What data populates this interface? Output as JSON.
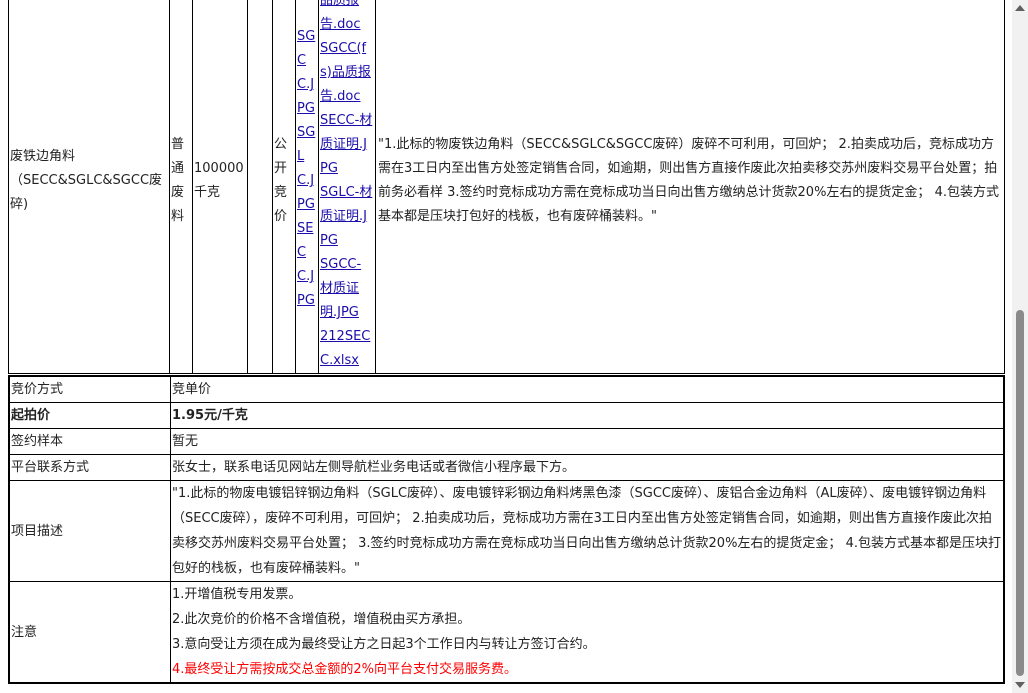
{
  "item_row": {
    "name": "废铁边角料（SECC&SGLC&SGCC废碎)",
    "type": "普通废料",
    "quantity": "100000千克",
    "mode": "公开竞价",
    "attachments_a": [
      "SGCC.JPG",
      "SGLC.JPG",
      "SECC.JPG"
    ],
    "attachments_b": [
      "品质报告.doc",
      "SGCC(fs)品质报告.doc",
      "SECC-材质证明.JPG",
      "SGLC-材质证明.JPG",
      "SGCC-材质证明.JPG",
      "212SECC.xlsx"
    ],
    "description": "\"1.此标的物废铁边角料（SECC&SGLC&SGCC废碎）废碎不可利用，可回炉； 2.拍卖成功后，竞标成功方需在3工日内至出售方处签定销售合同，如逾期，则出售方直接作废此次拍卖移交苏州废料交易平台处置；拍前务必看样 3.签约时竞标成功方需在竞标成功当日向出售方缴纳总计货款20%左右的提货定金； 4.包装方式基本都是压块打包好的栈板，也有废碎桶装料。\""
  },
  "info": {
    "bid_method_label": "竞价方式",
    "bid_method_value": "竞单价",
    "start_price_label": "起拍价",
    "start_price_value": "1.95元/千克",
    "contract_sample_label": "签约样本",
    "contract_sample_value": "暂无",
    "contact_label": "平台联系方式",
    "contact_value": "张女士，联系电话见网站左侧导航栏业务电话或者微信小程序最下方。",
    "project_desc_label": "项目描述",
    "project_desc_value": "\"1.此标的物废电镀铝锌钢边角料（SGLC废碎）、废电镀锌彩钢边角料烤黑色漆（SGCC废碎）、废铝合金边角料（AL废碎）、废电镀锌钢边角料（SECC废碎），废碎不可利用，可回炉； 2.拍卖成功后，竞标成功方需在3工日内至出售方处签定销售合同，如逾期，则出售方直接作废此次拍卖移交苏州废料交易平台处置； 3.签约时竞标成功方需在竞标成功当日向出售方缴纳总计货款20%左右的提货定金； 4.包装方式基本都是压块打包好的栈板，也有废碎桶装料。\"",
    "notes_label": "注意",
    "notes": [
      "1.开增值税专用发票。",
      "2.此次竞价的价格不含增值税，增值税由买方承担。",
      "3.意向受让方须在成为最终受让方之日起3个工作日内与转让方签订合约。",
      "4.最终受让方需按成交总金额的2%向平台支付交易服务费。"
    ],
    "note_highlight_color": "#ff0000"
  }
}
